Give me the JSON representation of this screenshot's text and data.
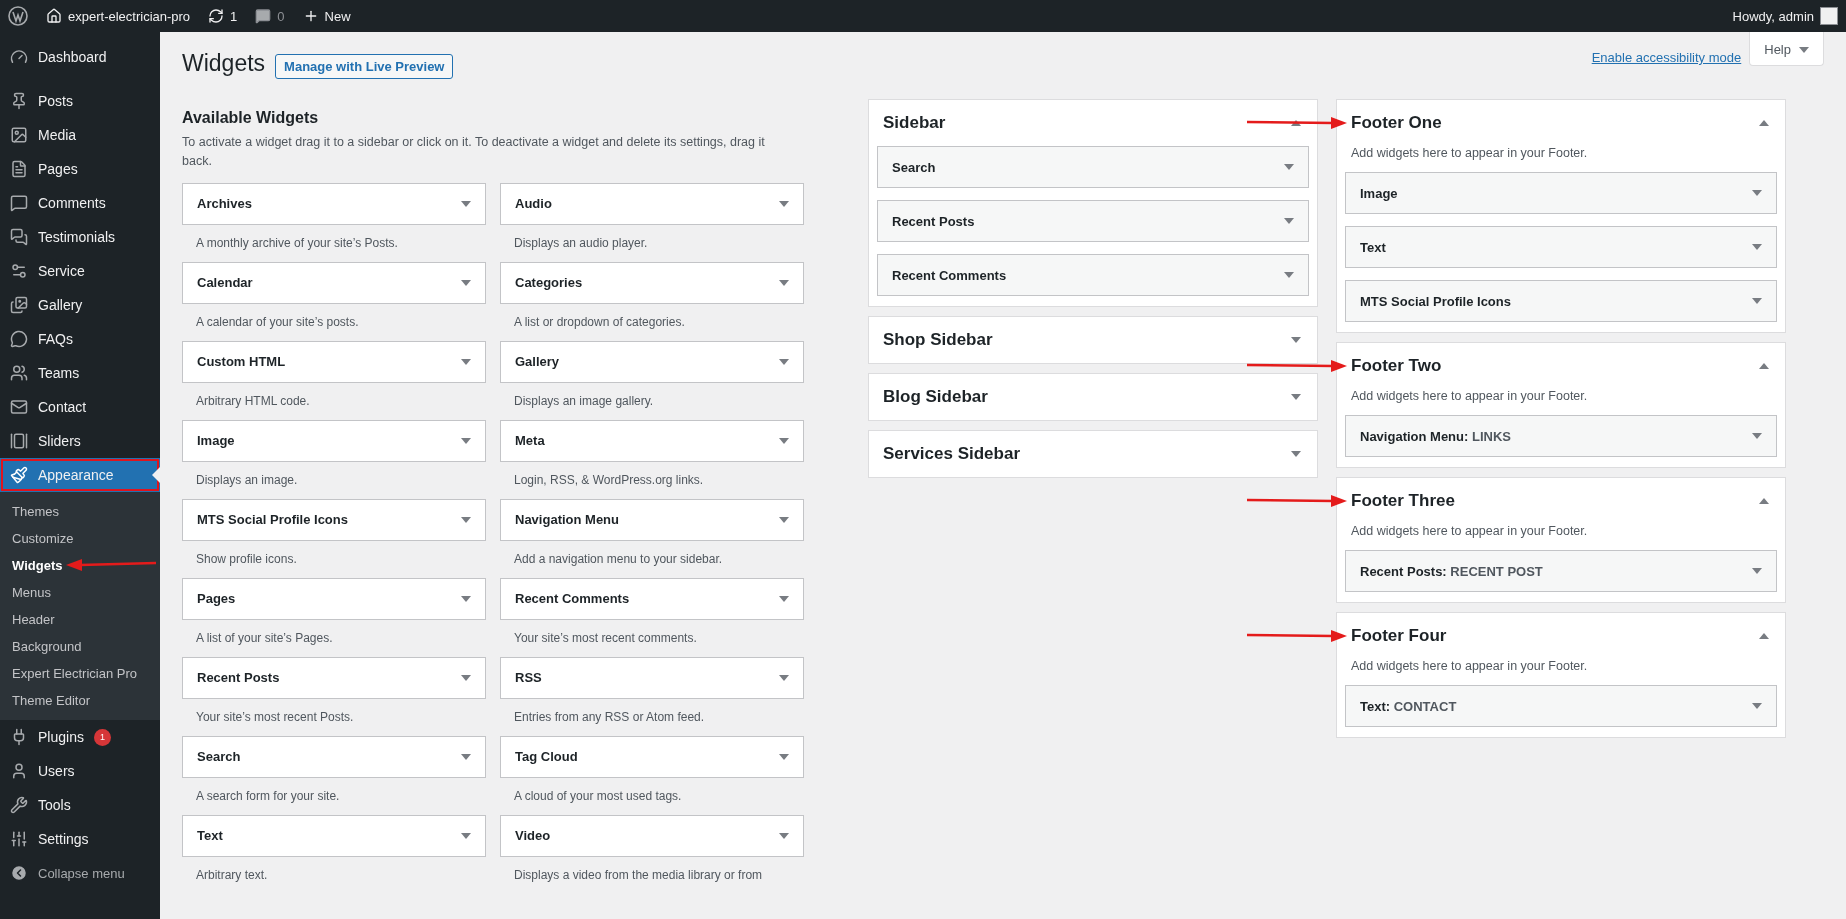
{
  "admin_bar": {
    "site": "expert-electrician-pro",
    "updates": "1",
    "comments": "0",
    "new": "New",
    "greeting": "Howdy, admin"
  },
  "menu": [
    {
      "label": "Dashboard",
      "selected": false
    },
    {
      "label": "Posts",
      "selected": false
    },
    {
      "label": "Media",
      "selected": false
    },
    {
      "label": "Pages",
      "selected": false
    },
    {
      "label": "Comments",
      "selected": false
    },
    {
      "label": "Testimonials",
      "selected": false
    },
    {
      "label": "Service",
      "selected": false
    },
    {
      "label": "Gallery",
      "selected": false
    },
    {
      "label": "FAQs",
      "selected": false
    },
    {
      "label": "Teams",
      "selected": false
    },
    {
      "label": "Contact",
      "selected": false
    },
    {
      "label": "Sliders",
      "selected": false
    },
    {
      "label": "Appearance",
      "selected": true,
      "highlighted": true,
      "children": [
        {
          "label": "Themes",
          "selected": false,
          "arrow": false
        },
        {
          "label": "Customize",
          "selected": false,
          "arrow": false
        },
        {
          "label": "Widgets",
          "selected": true,
          "arrow": true
        },
        {
          "label": "Menus",
          "selected": false,
          "arrow": false
        },
        {
          "label": "Header",
          "selected": false,
          "arrow": false
        },
        {
          "label": "Background",
          "selected": false,
          "arrow": false
        },
        {
          "label": "Expert Electrician Pro",
          "selected": false,
          "arrow": false
        },
        {
          "label": "Theme Editor",
          "selected": false,
          "arrow": false
        }
      ]
    },
    {
      "label": "Plugins",
      "selected": false,
      "badge": "1"
    },
    {
      "label": "Users",
      "selected": false
    },
    {
      "label": "Tools",
      "selected": false
    },
    {
      "label": "Settings",
      "selected": false
    }
  ],
  "collapse": "Collapse menu",
  "header": {
    "title": "Widgets",
    "button": "Manage with Live Preview",
    "accessibility_link": "Enable accessibility mode",
    "help": "Help"
  },
  "available": {
    "title": "Available Widgets",
    "description": "To activate a widget drag it to a sidebar or click on it. To deactivate a widget and delete its settings, drag it back.",
    "widgets": [
      {
        "title": "Archives",
        "description": "A monthly archive of your site’s Posts."
      },
      {
        "title": "Audio",
        "description": "Displays an audio player."
      },
      {
        "title": "Calendar",
        "description": "A calendar of your site’s posts."
      },
      {
        "title": "Categories",
        "description": "A list or dropdown of categories."
      },
      {
        "title": "Custom HTML",
        "description": "Arbitrary HTML code."
      },
      {
        "title": "Gallery",
        "description": "Displays an image gallery."
      },
      {
        "title": "Image",
        "description": "Displays an image."
      },
      {
        "title": "Meta",
        "description": "Login, RSS, & WordPress.org links."
      },
      {
        "title": "MTS Social Profile Icons",
        "description": "Show profile icons."
      },
      {
        "title": "Navigation Menu",
        "description": "Add a navigation menu to your sidebar."
      },
      {
        "title": "Pages",
        "description": "A list of your site’s Pages."
      },
      {
        "title": "Recent Comments",
        "description": "Your site’s most recent comments."
      },
      {
        "title": "Recent Posts",
        "description": "Your site’s most recent Posts."
      },
      {
        "title": "RSS",
        "description": "Entries from any RSS or Atom feed."
      },
      {
        "title": "Search",
        "description": "A search form for your site."
      },
      {
        "title": "Tag Cloud",
        "description": "A cloud of your most used tags."
      },
      {
        "title": "Text",
        "description": "Arbitrary text."
      },
      {
        "title": "Video",
        "description": "Displays a video from the media library or from"
      }
    ]
  },
  "sidebars": [
    {
      "name": "Sidebar",
      "expanded": true,
      "arrow": false,
      "widgets": [
        {
          "title": "Search"
        },
        {
          "title": "Recent Posts"
        },
        {
          "title": "Recent Comments"
        }
      ]
    },
    {
      "name": "Shop Sidebar",
      "expanded": false,
      "arrow": false
    },
    {
      "name": "Blog Sidebar",
      "expanded": false,
      "arrow": false
    },
    {
      "name": "Services Sidebar",
      "expanded": false,
      "arrow": false
    }
  ],
  "footers": [
    {
      "name": "Footer One",
      "expanded": true,
      "arrow": true,
      "description": "Add widgets here to appear in your Footer.",
      "widgets": [
        {
          "title": "Image"
        },
        {
          "title": "Text"
        },
        {
          "title": "MTS Social Profile Icons"
        }
      ]
    },
    {
      "name": "Footer Two",
      "expanded": true,
      "arrow": true,
      "description": "Add widgets here to appear in your Footer.",
      "widgets": [
        {
          "title": "Navigation Menu:",
          "subtitle": "LINKS"
        }
      ]
    },
    {
      "name": "Footer Three",
      "expanded": true,
      "arrow": true,
      "description": "Add widgets here to appear in your Footer.",
      "widgets": [
        {
          "title": "Recent Posts:",
          "subtitle": "RECENT POST"
        }
      ]
    },
    {
      "name": "Footer Four",
      "expanded": true,
      "arrow": true,
      "description": "Add widgets here to appear in your Footer.",
      "widgets": [
        {
          "title": "Text:",
          "subtitle": "CONTACT"
        }
      ]
    }
  ]
}
